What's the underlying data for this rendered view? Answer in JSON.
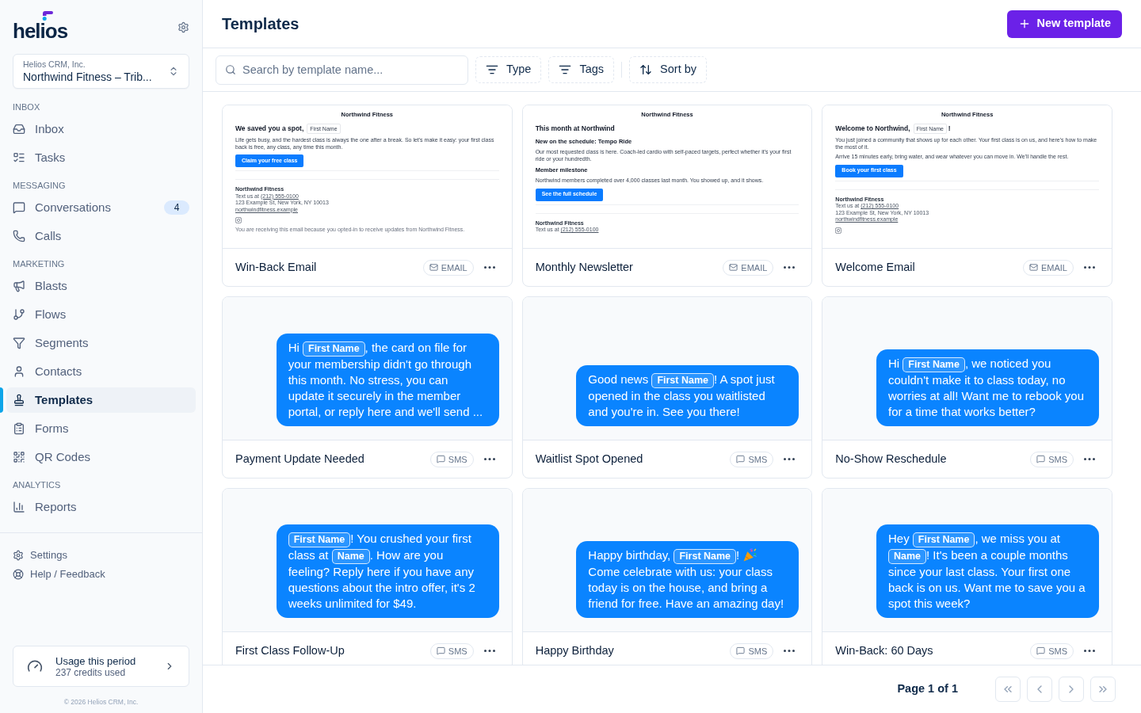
{
  "sidebar": {
    "logo": "helios",
    "workspace": {
      "org": "Helios CRM, Inc.",
      "name": "Northwind Fitness – Trib..."
    },
    "sections": [
      {
        "title": "INBOX",
        "items": [
          {
            "label": "Inbox",
            "selected": false
          },
          {
            "label": "Tasks",
            "selected": false
          }
        ]
      },
      {
        "title": "MESSAGING",
        "items": [
          {
            "label": "Conversations",
            "selected": false,
            "badge": "4"
          },
          {
            "label": "Calls",
            "selected": false
          }
        ]
      },
      {
        "title": "MARKETING",
        "items": [
          {
            "label": "Blasts",
            "selected": false
          },
          {
            "label": "Flows",
            "selected": false
          },
          {
            "label": "Segments",
            "selected": false
          },
          {
            "label": "Contacts",
            "selected": false
          },
          {
            "label": "Templates",
            "selected": true
          },
          {
            "label": "Forms",
            "selected": false
          },
          {
            "label": "QR Codes",
            "selected": false
          }
        ]
      },
      {
        "title": "ANALYTICS",
        "items": [
          {
            "label": "Reports",
            "selected": false
          }
        ]
      }
    ],
    "links": [
      "Settings",
      "Help / Feedback"
    ],
    "usage": {
      "title": "Usage this period",
      "detail": "237 credits used"
    },
    "copyright": "© 2026 Helios CRM, Inc."
  },
  "header": {
    "title": "Templates",
    "new_button": "New template"
  },
  "toolbar": {
    "search": {
      "placeholder": "Search by template name..."
    },
    "filters": [
      "Type",
      "Tags"
    ],
    "sort": "Sort by"
  },
  "templates": [
    {
      "title": "Win-Back Email",
      "kind": "email",
      "tag": "EMAIL",
      "email": {
        "brand": "Northwind Fitness",
        "blocks": [
          {
            "kind": "heading",
            "parts": [
              {
                "kind": "text",
                "text": "We saved you a spot,"
              },
              {
                "kind": "field",
                "text": "First Name"
              }
            ]
          },
          {
            "kind": "paragraph",
            "text": "Life gets busy, and the hardest class is always the one after a break. So let's make it easy: your first class back is free, any class, any time this month."
          },
          {
            "kind": "button",
            "text": "Claim your free class"
          },
          {
            "kind": "divider"
          },
          {
            "kind": "divider"
          }
        ],
        "footer": {
          "org": "Northwind Fitness",
          "phone_label": "Text us at",
          "phone": "(212) 555-0100",
          "address": "123 Example St, New York, NY 10013",
          "website": "northwindfitness.example",
          "social": true,
          "disclaimer": "You are receiving this email because you opted-in to receive updates from Northwind Fitness."
        }
      }
    },
    {
      "title": "Monthly Newsletter",
      "kind": "email",
      "tag": "EMAIL",
      "email": {
        "brand": "Northwind Fitness",
        "blocks": [
          {
            "kind": "heading",
            "parts": [
              {
                "kind": "text",
                "text": "This month at Northwind"
              }
            ]
          },
          {
            "kind": "subheading",
            "text": "New on the schedule: Tempo Ride"
          },
          {
            "kind": "paragraph",
            "text": "Our most requested class is here. Coach-led cardio with self-paced targets, perfect whether it's your first ride or your hundredth."
          },
          {
            "kind": "subheading",
            "text": "Member milestone"
          },
          {
            "kind": "paragraph",
            "text": "Northwind members completed over 4,000 classes last month. You showed up, and it shows."
          },
          {
            "kind": "button",
            "text": "See the full schedule"
          },
          {
            "kind": "divider"
          },
          {
            "kind": "divider"
          }
        ],
        "footer": {
          "org": "Northwind Fitness",
          "phone_label": "Text us at",
          "phone": "(212) 555-0100"
        }
      }
    },
    {
      "title": "Welcome Email",
      "kind": "email",
      "tag": "EMAIL",
      "email": {
        "brand": "Northwind Fitness",
        "blocks": [
          {
            "kind": "heading",
            "parts": [
              {
                "kind": "text",
                "text": "Welcome to Northwind,"
              },
              {
                "kind": "field",
                "text": "First Name"
              },
              {
                "kind": "text",
                "text": "!"
              }
            ]
          },
          {
            "kind": "paragraph",
            "text": "You just joined a community that shows up for each other. Your first class is on us, and here's how to make the most of it."
          },
          {
            "kind": "paragraph",
            "text": "Arrive 15 minutes early, bring water, and wear whatever you can move in. We'll handle the rest."
          },
          {
            "kind": "button",
            "text": "Book your first class"
          },
          {
            "kind": "divider"
          },
          {
            "kind": "divider"
          }
        ],
        "footer": {
          "org": "Northwind Fitness",
          "phone_label": "Text us at",
          "phone": "(212) 555-0100",
          "address": "123 Example St, New York, NY 10013",
          "website": "northwindfitness.example",
          "social": true
        }
      }
    },
    {
      "title": "Payment Update Needed",
      "kind": "sms",
      "tag": "SMS",
      "message": [
        {
          "kind": "text",
          "text": "Hi "
        },
        {
          "kind": "field",
          "text": "First Name"
        },
        {
          "kind": "text",
          "text": ", the card on file for your membership didn't go through this month. No stress, you can update it securely in the member portal, or reply here and we'll send ..."
        }
      ]
    },
    {
      "title": "Waitlist Spot Opened",
      "kind": "sms",
      "tag": "SMS",
      "message": [
        {
          "kind": "text",
          "text": "Good news "
        },
        {
          "kind": "field",
          "text": "First Name"
        },
        {
          "kind": "text",
          "text": "! A spot just opened in the class you waitlisted and you're in. See you there!"
        }
      ]
    },
    {
      "title": "No-Show Reschedule",
      "kind": "sms",
      "tag": "SMS",
      "message": [
        {
          "kind": "text",
          "text": "Hi "
        },
        {
          "kind": "field",
          "text": "First Name"
        },
        {
          "kind": "text",
          "text": ", we noticed you couldn't make it to class today, no worries at all! Want me to rebook you for a time that works better?"
        }
      ]
    },
    {
      "title": "First Class Follow-Up",
      "kind": "sms",
      "tag": "SMS",
      "message": [
        {
          "kind": "field",
          "text": "First Name"
        },
        {
          "kind": "text",
          "text": "! You crushed your first class at "
        },
        {
          "kind": "field",
          "text": "Name"
        },
        {
          "kind": "text",
          "text": ". How are you feeling? Reply here if you have any questions about the intro offer, it's 2 weeks unlimited for $49."
        }
      ]
    },
    {
      "title": "Happy Birthday",
      "kind": "sms",
      "tag": "SMS",
      "message": [
        {
          "kind": "text",
          "text": "Happy birthday, "
        },
        {
          "kind": "field",
          "text": "First Name"
        },
        {
          "kind": "text",
          "text": "! "
        },
        {
          "kind": "emoji"
        },
        {
          "kind": "text",
          "text": " Come celebrate with us: your class today is on the house, and bring a friend for free. Have an amazing day!"
        }
      ]
    },
    {
      "title": "Win-Back: 60 Days",
      "kind": "sms",
      "tag": "SMS",
      "message": [
        {
          "kind": "text",
          "text": "Hey "
        },
        {
          "kind": "field",
          "text": "First Name"
        },
        {
          "kind": "text",
          "text": ", we miss you at "
        },
        {
          "kind": "field",
          "text": "Name"
        },
        {
          "kind": "text",
          "text": "! It's been a couple months since your last class. Your first one back is on us. Want me to save you a spot this week?"
        }
      ]
    }
  ],
  "pagination": {
    "label": "Page 1 of 1",
    "buttons": [
      {
        "disabled": true
      },
      {
        "disabled": true
      },
      {
        "disabled": true
      },
      {
        "disabled": true
      }
    ]
  }
}
